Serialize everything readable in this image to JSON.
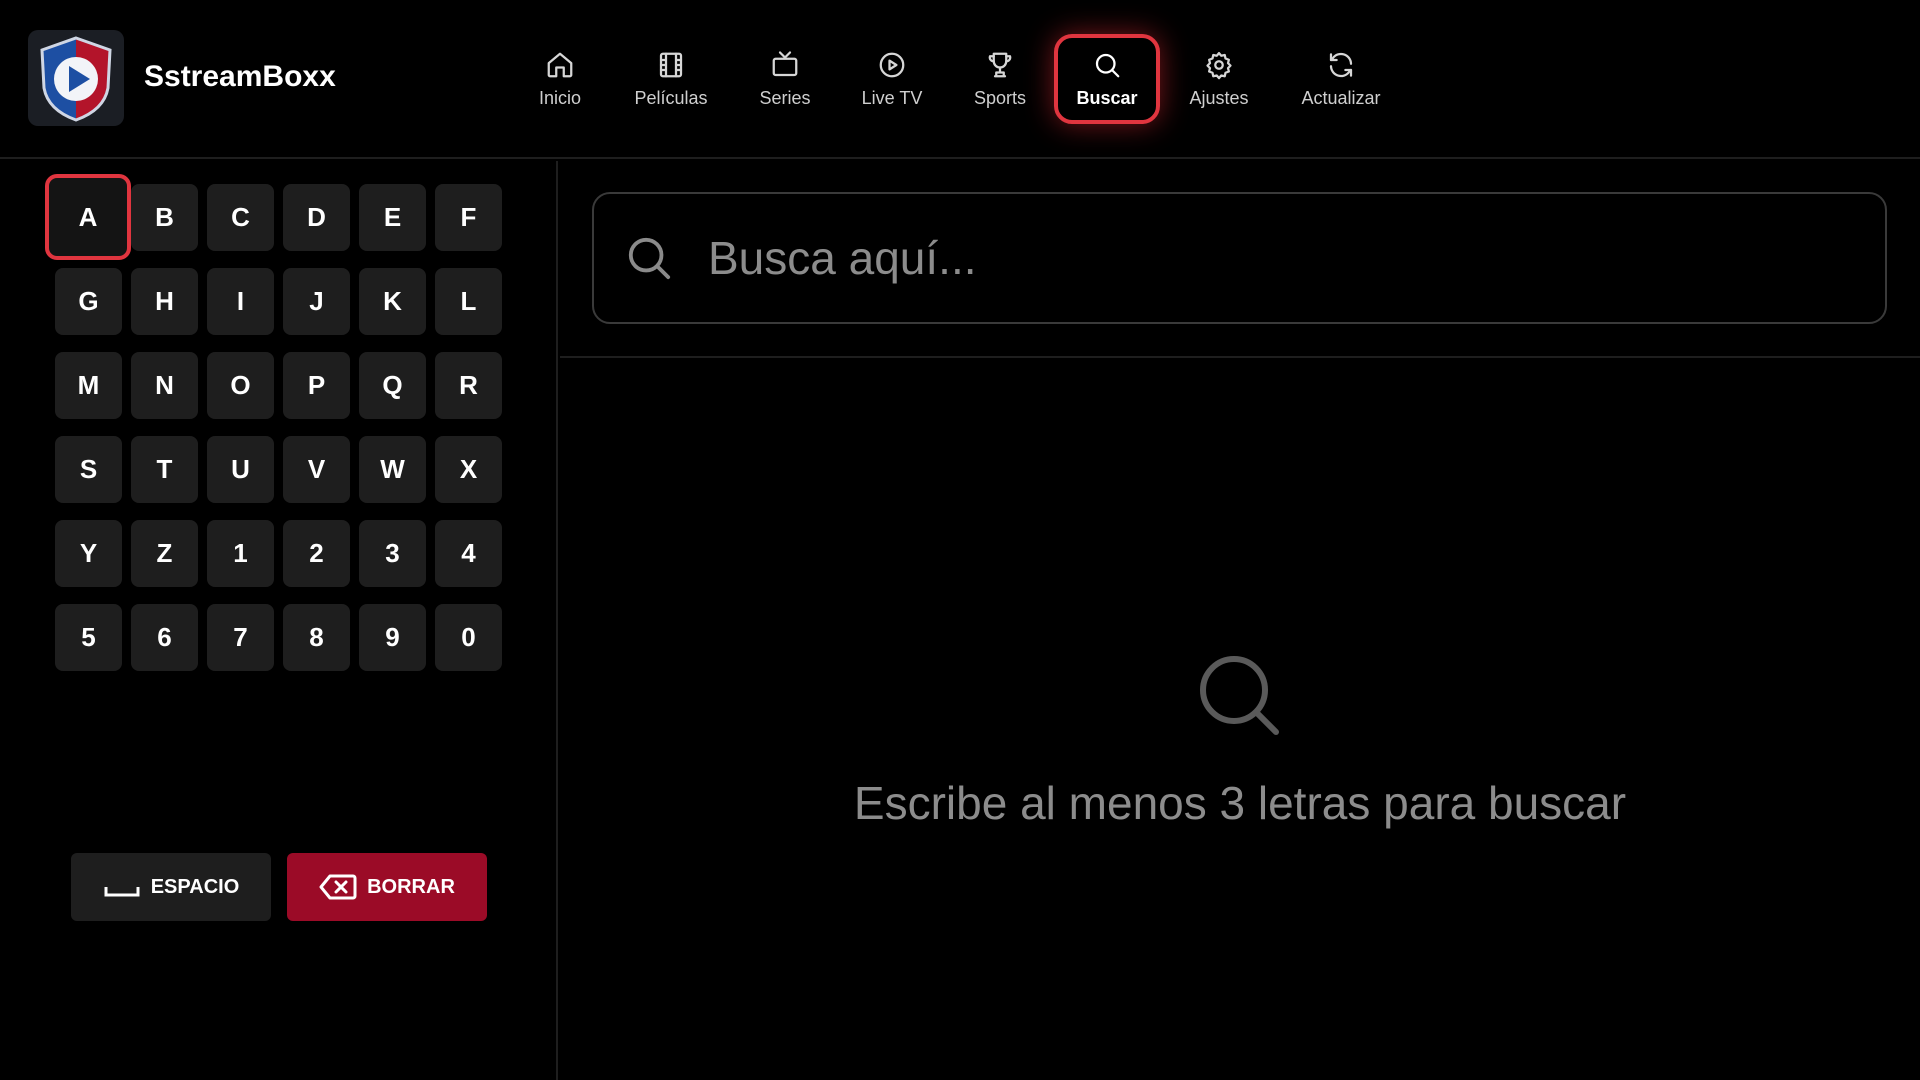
{
  "app": {
    "name": "SstreamBoxx"
  },
  "nav": {
    "items": [
      {
        "label": "Inicio",
        "icon": "home-icon"
      },
      {
        "label": "Películas",
        "icon": "film-icon"
      },
      {
        "label": "Series",
        "icon": "tv-icon"
      },
      {
        "label": "Live TV",
        "icon": "play-circle-icon"
      },
      {
        "label": "Sports",
        "icon": "trophy-icon"
      },
      {
        "label": "Buscar",
        "icon": "search-icon",
        "active": true
      },
      {
        "label": "Ajustes",
        "icon": "gear-icon"
      },
      {
        "label": "Actualizar",
        "icon": "refresh-icon"
      }
    ]
  },
  "keyboard": {
    "keys": [
      "A",
      "B",
      "C",
      "D",
      "E",
      "F",
      "G",
      "H",
      "I",
      "J",
      "K",
      "L",
      "M",
      "N",
      "O",
      "P",
      "Q",
      "R",
      "S",
      "T",
      "U",
      "V",
      "W",
      "X",
      "Y",
      "Z",
      "1",
      "2",
      "3",
      "4",
      "5",
      "6",
      "7",
      "8",
      "9",
      "0"
    ],
    "focused_key": "A",
    "space_label": "ESPACIO",
    "delete_label": "BORRAR"
  },
  "search": {
    "placeholder": "Busca aquí...",
    "value": ""
  },
  "empty_state": {
    "message": "Escribe al menos 3 letras para buscar"
  },
  "colors": {
    "accent": "#e0353f",
    "delete_button": "#9b0b27",
    "key_background": "#1e1e1e",
    "background": "#000000"
  }
}
